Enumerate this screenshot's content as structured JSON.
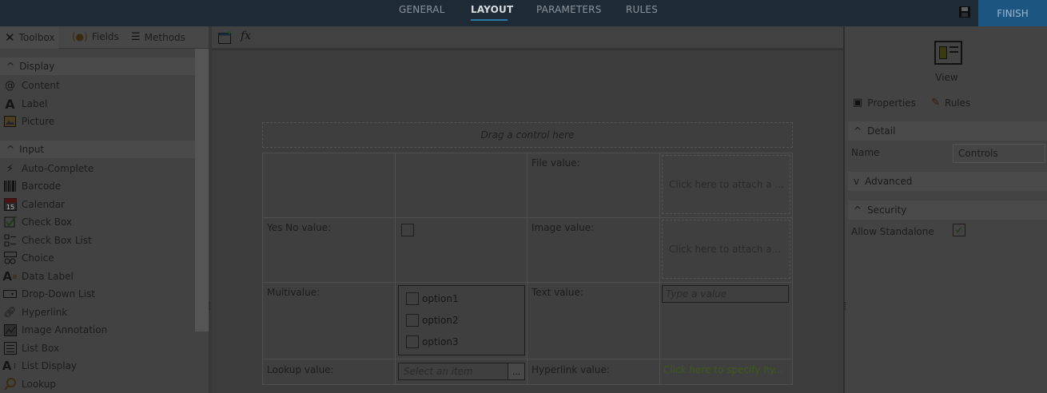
{
  "topbar": {
    "tabs": [
      {
        "label": "GENERAL"
      },
      {
        "label": "LAYOUT",
        "active": true
      },
      {
        "label": "PARAMETERS"
      },
      {
        "label": "RULES"
      }
    ],
    "finish_label": "FINISH"
  },
  "toolbox": {
    "tabs": [
      "Toolbox",
      "Fields",
      "Methods"
    ],
    "groups": {
      "display": "Display",
      "input": "Input"
    },
    "display_items": [
      "Content",
      "Label",
      "Picture"
    ],
    "input_items": [
      "Auto-Complete",
      "Barcode",
      "Calendar",
      "Check Box",
      "Check Box List",
      "Choice",
      "Data Label",
      "Drop-Down List",
      "Hyperlink",
      "Image Annotation",
      "List Box",
      "List Display",
      "Lookup"
    ],
    "calendar_day": "15"
  },
  "canvas": {
    "dropzone": "Drag a control here",
    "labels": {
      "file": "File value:",
      "yesno": "Yes No value:",
      "image": "Image value:",
      "multi": "Multivalue:",
      "text": "Text value:",
      "lookup": "Lookup value:",
      "hyperlink": "Hyperlink value:"
    },
    "attach_file": "Click here to attach a ...",
    "attach_image": "Click here to attach a...",
    "options": [
      "option1",
      "option2",
      "option3"
    ],
    "text_placeholder": "Type a value",
    "lookup_placeholder": "Select an item",
    "lookup_button": "...",
    "hyperlink_text": "Click here to specify hy..."
  },
  "properties": {
    "view_label": "View",
    "tabs": [
      "Properties",
      "Rules"
    ],
    "sections": {
      "detail": "Detail",
      "advanced": "Advanced",
      "security": "Security"
    },
    "name_label": "Name",
    "name_value": "Controls",
    "standalone_label": "Allow Standalone",
    "standalone_checked": true
  }
}
